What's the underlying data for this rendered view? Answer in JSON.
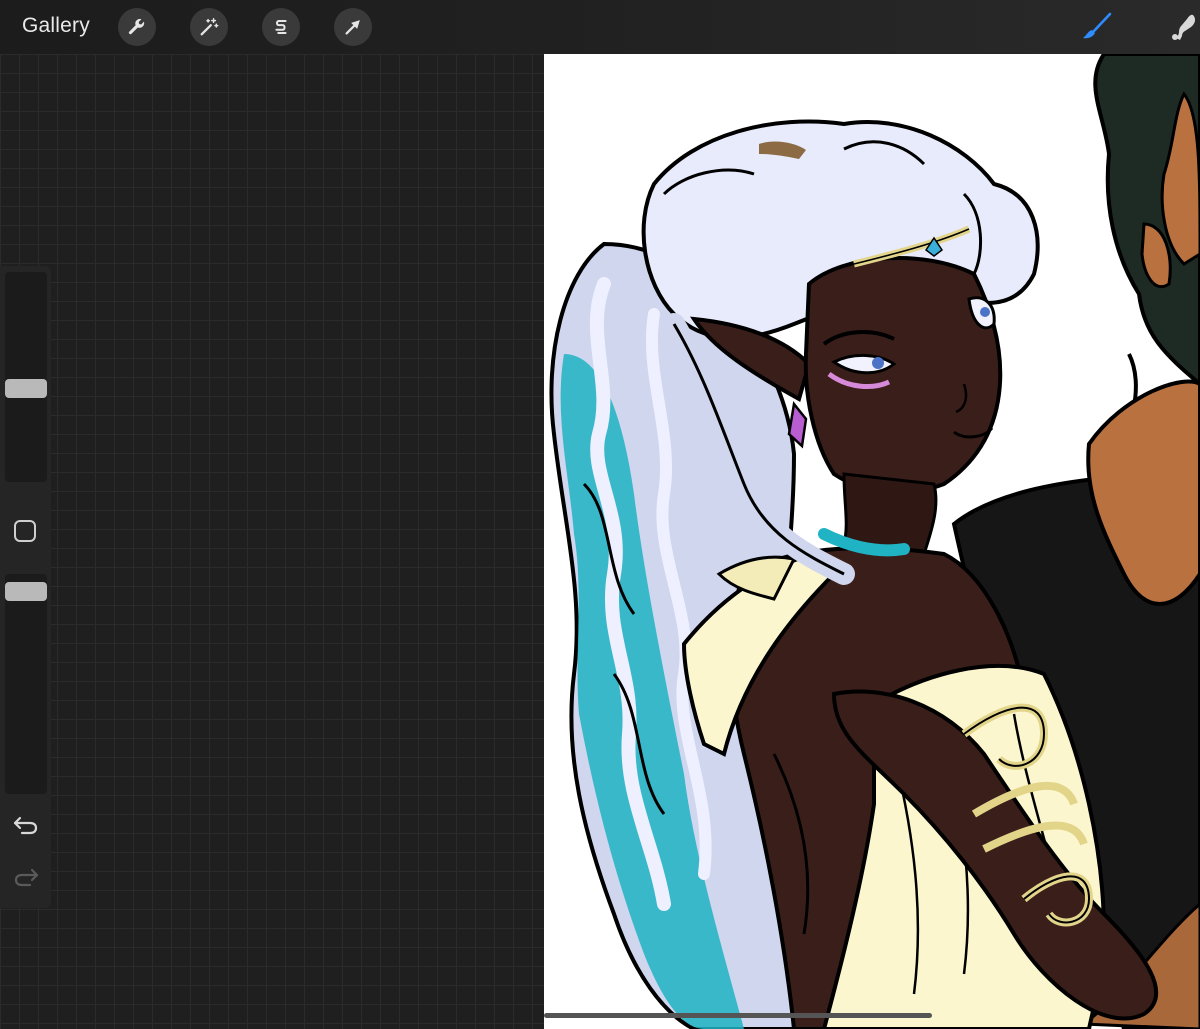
{
  "topbar": {
    "gallery_label": "Gallery",
    "tools": [
      {
        "icon": "wrench-icon",
        "name": "actions"
      },
      {
        "icon": "magic-wand-icon",
        "name": "adjustments"
      },
      {
        "icon": "selection-s-icon",
        "name": "selection"
      },
      {
        "icon": "arrow-cursor-icon",
        "name": "transform"
      }
    ],
    "right_tools": [
      {
        "icon": "brush-icon",
        "name": "paint",
        "color": "#2f8cff"
      },
      {
        "icon": "smudge-icon",
        "name": "smudge",
        "color": "#d8d8d8"
      }
    ]
  },
  "sidebar": {
    "brush_size_level": 0.44,
    "opacity_level": 0.96,
    "modify_icon": "square-icon",
    "undo_icon": "undo-icon",
    "redo_icon": "redo-icon"
  },
  "canvas": {
    "background": "#ffffff",
    "artwork": "illustration"
  },
  "colors": {
    "accent": "#2f8cff",
    "hair_light": "#e8ebfb",
    "hair_teal": "#1fb3c3",
    "skin_dark": "#3a1e1a",
    "dress": "#fcf6cf",
    "gold": "#e2d58a",
    "shirt_black": "#161616",
    "skin_tan": "#b9713f"
  }
}
